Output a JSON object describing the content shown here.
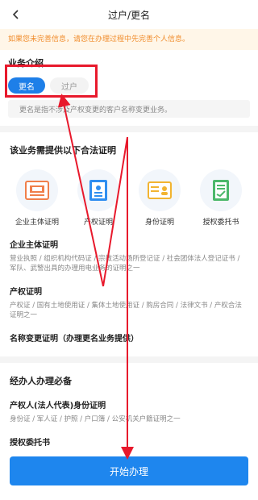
{
  "header": {
    "title": "过户/更名",
    "back_icon": "chevron-left-icon"
  },
  "notice": "如果您未完善信息，请您在办理过程中先完善个人信息。",
  "intro": {
    "title": "业务介绍",
    "tabs": [
      {
        "label": "更名",
        "active": true
      },
      {
        "label": "过户",
        "active": false
      }
    ],
    "description": "更名是指不涉及产权变更的客户名称变更业务。"
  },
  "certs": {
    "title": "该业务需提供以下合法证明",
    "icons": [
      {
        "label": "企业主体证明",
        "icon": "business-license-icon",
        "color": "#f07f4a"
      },
      {
        "label": "产权证明",
        "icon": "property-certificate-icon",
        "color": "#2f8ef0"
      },
      {
        "label": "身份证明",
        "icon": "id-card-icon",
        "color": "#f2b431"
      },
      {
        "label": "授权委托书",
        "icon": "authorization-letter-icon",
        "color": "#4cb86b"
      }
    ],
    "items": [
      {
        "title": "企业主体证明",
        "detail": "营业执照 / 组织机构代码证 / 宗教活动场所登记证 / 社会团体法人登记证书 / 军队、武警出具的办理用电业务的证明之一"
      },
      {
        "title": "产权证明",
        "detail": "产权证 / 国有土地使用证 / 集体土地使用证 / 购房合同 / 法律文书 / 产权合法证明之一"
      },
      {
        "title": "名称变更证明（办理更名业务提供）",
        "detail": ""
      }
    ]
  },
  "agent": {
    "title": "经办人办理必备",
    "items": [
      {
        "title": "产权人(法人代表)身份证明",
        "detail": "身份证 / 军人证 / 护照 / 户口簿 / 公安机关户籍证明之一"
      },
      {
        "title": "授权委托书",
        "detail": ""
      }
    ]
  },
  "actions": {
    "start_label": "开始办理"
  },
  "annotation_color": "#e8192c"
}
